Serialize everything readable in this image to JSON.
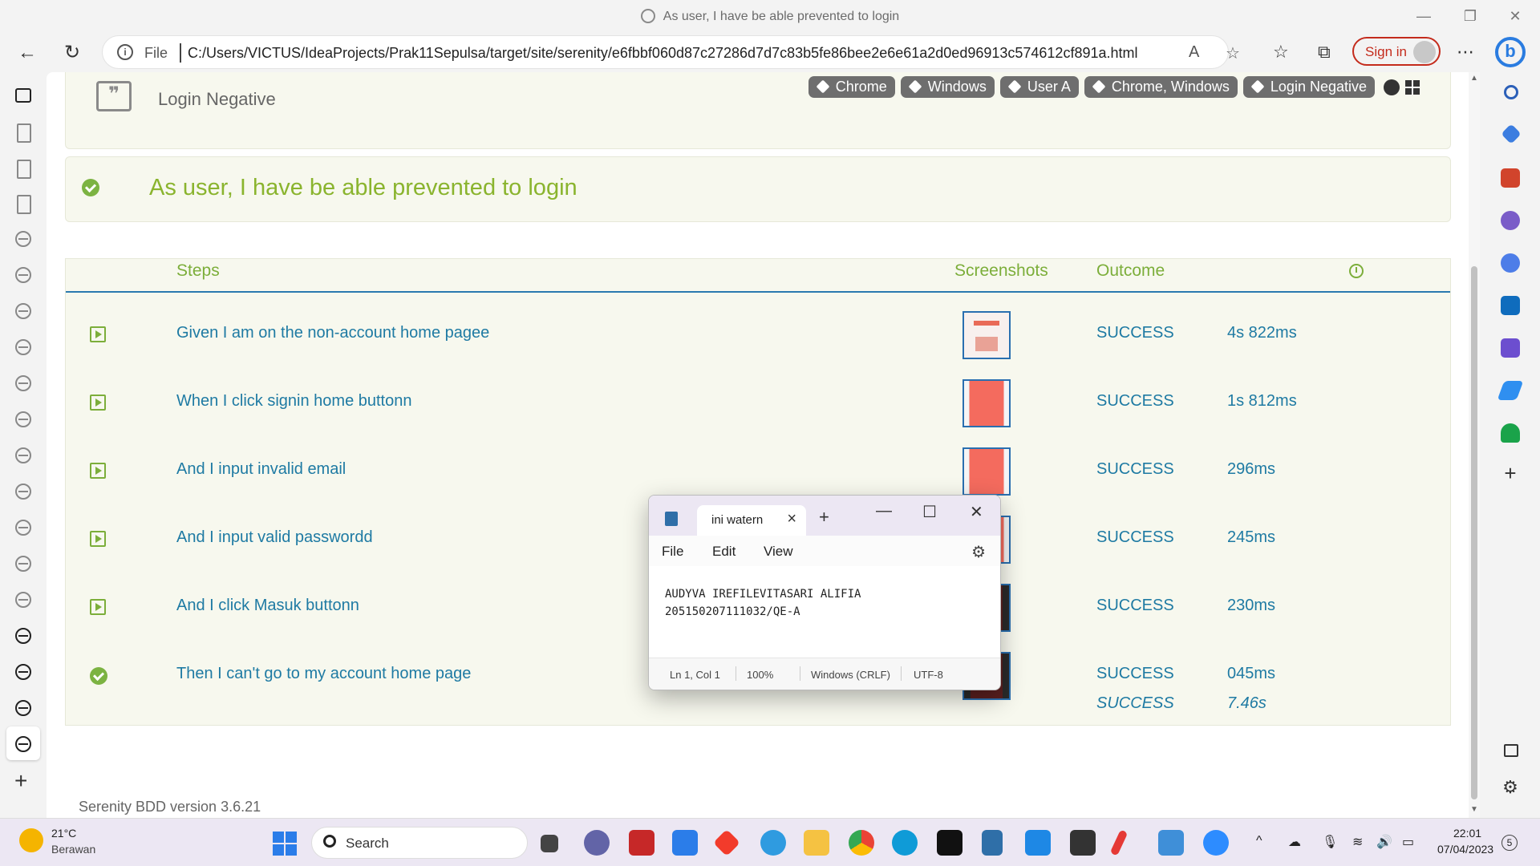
{
  "window": {
    "title": "As user, I have be able prevented to login"
  },
  "addressbar": {
    "file_label": "File",
    "url": "C:/Users/VICTUS/IdeaProjects/Prak11Sepulsa/target/site/serenity/e6fbbf060d87c27286d7d7c83b5fe86bee2e6e61a2d0ed96913c574612cf891a.html",
    "signin_label": "Sign in"
  },
  "report": {
    "feature_title": "Login Negative",
    "tags": [
      "Chrome",
      "Windows",
      "User A",
      "Chrome, Windows",
      "Login Negative"
    ],
    "scenario_title": "As user, I have be able prevented to login",
    "headers": {
      "steps": "Steps",
      "screenshots": "Screenshots",
      "outcome": "Outcome"
    },
    "steps": [
      {
        "text": "Given I am on the non-account home pagee",
        "outcome": "SUCCESS",
        "duration": "4s 822ms"
      },
      {
        "text": "When I click signin home buttonn",
        "outcome": "SUCCESS",
        "duration": "1s 812ms"
      },
      {
        "text": "And I input invalid email",
        "outcome": "SUCCESS",
        "duration": "296ms"
      },
      {
        "text": "And I input valid passwordd",
        "outcome": "SUCCESS",
        "duration": "245ms"
      },
      {
        "text": "And I click Masuk buttonn",
        "outcome": "SUCCESS",
        "duration": "230ms"
      },
      {
        "text": "Then I can't go to my account home page",
        "outcome": "SUCCESS",
        "duration": "045ms"
      }
    ],
    "total": {
      "outcome": "SUCCESS",
      "duration": "7.46s"
    },
    "version": "Serenity BDD version 3.6.21"
  },
  "notepad": {
    "tab_title": "ini watern",
    "menu": {
      "file": "File",
      "edit": "Edit",
      "view": "View"
    },
    "content_line1": "AUDYVA IREFILEVITASARI ALIFIA",
    "content_line2": "205150207111032/QE-A",
    "status": {
      "position": "Ln 1, Col 1",
      "zoom": "100%",
      "line_ending": "Windows (CRLF)",
      "encoding": "UTF-8"
    }
  },
  "taskbar": {
    "temperature": "21°C",
    "weather": "Berawan",
    "search_label": "Search",
    "time": "22:01",
    "date": "07/04/2023",
    "notification_count": "5"
  },
  "colors": {
    "accent_green": "#7cae3a",
    "link_blue": "#1e7aa3",
    "tag_gray": "#6e6e6e",
    "card_bg": "#f7f8ee"
  }
}
